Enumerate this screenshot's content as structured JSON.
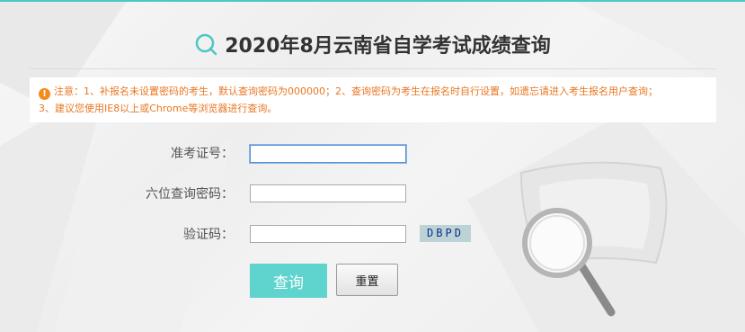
{
  "page": {
    "title": "2020年8月云南省自学考试成绩查询",
    "accent_color": "#4cc6c6"
  },
  "notice": {
    "icon": "exclamation-icon",
    "line1": "注意：1、补报名未设置密码的考生，默认查询密码为000000；2、查询密码为考生在报名时自行设置，如遗忘请进入考生报名用户查询；",
    "line2": "3、建议您使用IE8以上或Chrome等浏览器进行查询。"
  },
  "form": {
    "exam_id_label": "准考证号：",
    "exam_id_value": "",
    "password_label": "六位查询密码：",
    "password_value": "",
    "captcha_label": "验证码：",
    "captcha_value": "",
    "captcha_image_text": "DBPD",
    "query_button": "查询",
    "reset_button": "重置"
  }
}
